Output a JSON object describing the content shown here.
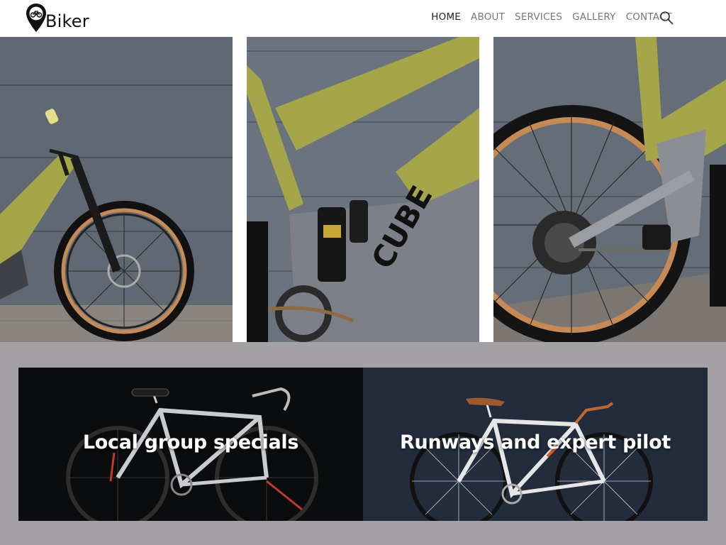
{
  "brand": {
    "name": "Biker",
    "logo_icon": "bike-location-pin-icon"
  },
  "nav": {
    "items": [
      {
        "label": "HOME",
        "active": true
      },
      {
        "label": "ABOUT",
        "active": false
      },
      {
        "label": "SERVICES",
        "active": false
      },
      {
        "label": "GALLERY",
        "active": false
      },
      {
        "label": "CONTACT",
        "active": false
      }
    ],
    "search_icon": "search-icon"
  },
  "gallery": {
    "photos": [
      {
        "subject": "olive mountain bike front wheel"
      },
      {
        "subject": "mountain bike frame and shock"
      },
      {
        "subject": "mountain bike rear wheel and drivetrain"
      }
    ]
  },
  "promos": {
    "cards": [
      {
        "title": "Local group specials"
      },
      {
        "title": "Runways and expert pilot"
      }
    ]
  },
  "colors": {
    "band": "#a3a1a3",
    "frame_olive": "#a5a64a",
    "frame_grey": "#7d8088",
    "wall": "#5d6672",
    "tire_tan": "#c58a55"
  }
}
